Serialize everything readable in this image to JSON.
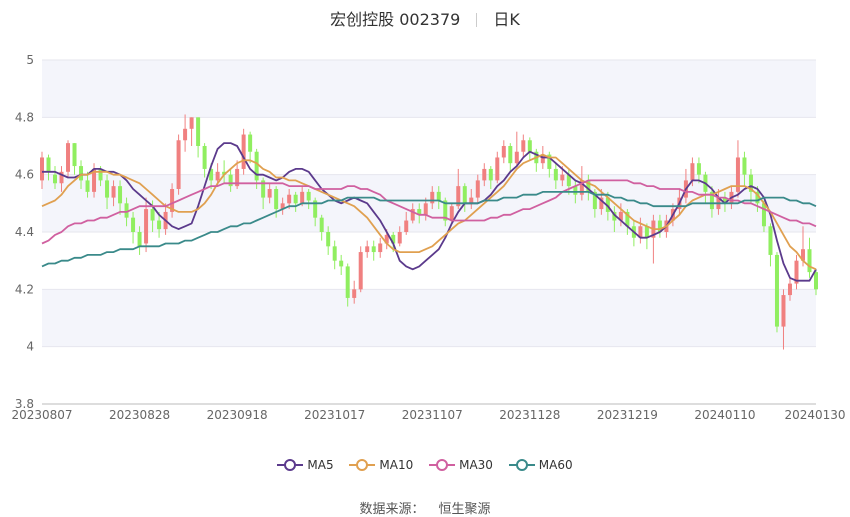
{
  "header": {
    "title": "宏创控股 002379",
    "period": "日K"
  },
  "source": {
    "label": "数据来源：",
    "name": "恒生聚源"
  },
  "chart_data": {
    "type": "candlestick",
    "title": "宏创控股 002379",
    "ylim": [
      3.8,
      5
    ],
    "yticks": [
      3.8,
      4,
      4.2,
      4.4,
      4.6,
      4.8,
      5
    ],
    "ytick_labels": [
      "3.8",
      "4",
      "4.2",
      "4.4",
      "4.6",
      "4.8",
      "5"
    ],
    "xtick_labels": [
      "20230807",
      "20230828",
      "20230918",
      "20231017",
      "20231107",
      "20231128",
      "20231219",
      "20240110",
      "20240130"
    ],
    "xtick_index": [
      0,
      15,
      30,
      45,
      60,
      75,
      90,
      105,
      119
    ],
    "grid": true,
    "colors": {
      "up": "#f08080",
      "down": "#90ee60",
      "ma5": "#5b3a8c",
      "ma10": "#e0a050",
      "ma30": "#d060a0",
      "ma60": "#3a8a8a"
    },
    "candles": [
      [
        4.58,
        4.66,
        4.68,
        4.55
      ],
      [
        4.66,
        4.61,
        4.67,
        4.58
      ],
      [
        4.6,
        4.57,
        4.63,
        4.55
      ],
      [
        4.57,
        4.61,
        4.63,
        4.54
      ],
      [
        4.61,
        4.71,
        4.72,
        4.59
      ],
      [
        4.71,
        4.63,
        4.71,
        4.6
      ],
      [
        4.63,
        4.58,
        4.65,
        4.55
      ],
      [
        4.58,
        4.54,
        4.61,
        4.52
      ],
      [
        4.54,
        4.62,
        4.64,
        4.52
      ],
      [
        4.62,
        4.58,
        4.63,
        4.56
      ],
      [
        4.58,
        4.52,
        4.6,
        4.48
      ],
      [
        4.52,
        4.56,
        4.58,
        4.49
      ],
      [
        4.56,
        4.5,
        4.58,
        4.46
      ],
      [
        4.5,
        4.45,
        4.52,
        4.42
      ],
      [
        4.45,
        4.4,
        4.47,
        4.36
      ],
      [
        4.4,
        4.35,
        4.42,
        4.32
      ],
      [
        4.36,
        4.48,
        4.52,
        4.33
      ],
      [
        4.48,
        4.44,
        4.51,
        4.4
      ],
      [
        4.44,
        4.41,
        4.47,
        4.38
      ],
      [
        4.41,
        4.47,
        4.5,
        4.39
      ],
      [
        4.47,
        4.55,
        4.57,
        4.45
      ],
      [
        4.55,
        4.72,
        4.74,
        4.53
      ],
      [
        4.72,
        4.76,
        4.81,
        4.68
      ],
      [
        4.76,
        4.8,
        4.8,
        4.7
      ],
      [
        4.8,
        4.7,
        4.8,
        4.66
      ],
      [
        4.7,
        4.62,
        4.71,
        4.59
      ],
      [
        4.62,
        4.58,
        4.64,
        4.55
      ],
      [
        4.58,
        4.61,
        4.64,
        4.56
      ],
      [
        4.61,
        4.6,
        4.65,
        4.57
      ],
      [
        4.6,
        4.56,
        4.62,
        4.54
      ],
      [
        4.56,
        4.62,
        4.65,
        4.55
      ],
      [
        4.62,
        4.74,
        4.76,
        4.6
      ],
      [
        4.74,
        4.68,
        4.75,
        4.64
      ],
      [
        4.68,
        4.58,
        4.69,
        4.55
      ],
      [
        4.58,
        4.52,
        4.59,
        4.48
      ],
      [
        4.52,
        4.55,
        4.57,
        4.5
      ],
      [
        4.55,
        4.48,
        4.56,
        4.45
      ],
      [
        4.48,
        4.5,
        4.52,
        4.46
      ],
      [
        4.5,
        4.53,
        4.55,
        4.48
      ],
      [
        4.53,
        4.5,
        4.54,
        4.47
      ],
      [
        4.5,
        4.54,
        4.56,
        4.49
      ],
      [
        4.54,
        4.51,
        4.55,
        4.48
      ],
      [
        4.51,
        4.45,
        4.52,
        4.42
      ],
      [
        4.45,
        4.4,
        4.46,
        4.37
      ],
      [
        4.4,
        4.35,
        4.42,
        4.32
      ],
      [
        4.35,
        4.3,
        4.37,
        4.27
      ],
      [
        4.3,
        4.28,
        4.32,
        4.25
      ],
      [
        4.28,
        4.17,
        4.29,
        4.14
      ],
      [
        4.17,
        4.2,
        4.23,
        4.15
      ],
      [
        4.2,
        4.33,
        4.35,
        4.19
      ],
      [
        4.33,
        4.35,
        4.37,
        4.31
      ],
      [
        4.35,
        4.33,
        4.37,
        4.3
      ],
      [
        4.33,
        4.36,
        4.38,
        4.31
      ],
      [
        4.36,
        4.39,
        4.41,
        4.34
      ],
      [
        4.39,
        4.36,
        4.4,
        4.33
      ],
      [
        4.36,
        4.4,
        4.42,
        4.35
      ],
      [
        4.4,
        4.44,
        4.47,
        4.39
      ],
      [
        4.44,
        4.48,
        4.5,
        4.43
      ],
      [
        4.48,
        4.46,
        4.5,
        4.43
      ],
      [
        4.46,
        4.5,
        4.52,
        4.44
      ],
      [
        4.5,
        4.54,
        4.56,
        4.48
      ],
      [
        4.54,
        4.51,
        4.56,
        4.48
      ],
      [
        4.51,
        4.44,
        4.52,
        4.42
      ],
      [
        4.44,
        4.49,
        4.5,
        4.43
      ],
      [
        4.49,
        4.56,
        4.62,
        4.48
      ],
      [
        4.56,
        4.5,
        4.57,
        4.47
      ],
      [
        4.5,
        4.52,
        4.55,
        4.48
      ],
      [
        4.52,
        4.58,
        4.6,
        4.5
      ],
      [
        4.58,
        4.62,
        4.64,
        4.56
      ],
      [
        4.62,
        4.58,
        4.63,
        4.55
      ],
      [
        4.58,
        4.66,
        4.68,
        4.57
      ],
      [
        4.66,
        4.7,
        4.72,
        4.64
      ],
      [
        4.7,
        4.64,
        4.71,
        4.61
      ],
      [
        4.64,
        4.68,
        4.75,
        4.63
      ],
      [
        4.68,
        4.72,
        4.74,
        4.66
      ],
      [
        4.72,
        4.68,
        4.73,
        4.65
      ],
      [
        4.68,
        4.64,
        4.69,
        4.61
      ],
      [
        4.64,
        4.67,
        4.7,
        4.62
      ],
      [
        4.67,
        4.62,
        4.68,
        4.59
      ],
      [
        4.62,
        4.58,
        4.64,
        4.55
      ],
      [
        4.58,
        4.6,
        4.63,
        4.56
      ],
      [
        4.6,
        4.56,
        4.62,
        4.53
      ],
      [
        4.56,
        4.53,
        4.58,
        4.5
      ],
      [
        4.53,
        4.58,
        4.63,
        4.51
      ],
      [
        4.58,
        4.54,
        4.6,
        4.51
      ],
      [
        4.54,
        4.48,
        4.55,
        4.45
      ],
      [
        4.48,
        4.52,
        4.55,
        4.46
      ],
      [
        4.52,
        4.47,
        4.54,
        4.44
      ],
      [
        4.47,
        4.44,
        4.49,
        4.4
      ],
      [
        4.44,
        4.47,
        4.5,
        4.42
      ],
      [
        4.47,
        4.42,
        4.48,
        4.39
      ],
      [
        4.42,
        4.38,
        4.44,
        4.35
      ],
      [
        4.38,
        4.42,
        4.45,
        4.36
      ],
      [
        4.42,
        4.38,
        4.43,
        4.34
      ],
      [
        4.38,
        4.44,
        4.46,
        4.29
      ],
      [
        4.44,
        4.4,
        4.46,
        4.38
      ],
      [
        4.4,
        4.44,
        4.46,
        4.38
      ],
      [
        4.44,
        4.48,
        4.5,
        4.42
      ],
      [
        4.48,
        4.52,
        4.55,
        4.46
      ],
      [
        4.52,
        4.58,
        4.62,
        4.5
      ],
      [
        4.58,
        4.64,
        4.66,
        4.56
      ],
      [
        4.64,
        4.6,
        4.66,
        4.57
      ],
      [
        4.6,
        4.54,
        4.61,
        4.5
      ],
      [
        4.54,
        4.48,
        4.56,
        4.45
      ],
      [
        4.48,
        4.52,
        4.55,
        4.46
      ],
      [
        4.52,
        4.5,
        4.54,
        4.47
      ],
      [
        4.5,
        4.54,
        4.56,
        4.48
      ],
      [
        4.54,
        4.66,
        4.72,
        4.52
      ],
      [
        4.66,
        4.6,
        4.68,
        4.56
      ],
      [
        4.6,
        4.54,
        4.62,
        4.5
      ],
      [
        4.54,
        4.5,
        4.56,
        4.47
      ],
      [
        4.5,
        4.42,
        4.51,
        4.4
      ],
      [
        4.42,
        4.32,
        4.43,
        4.28
      ],
      [
        4.32,
        4.07,
        4.33,
        4.05
      ],
      [
        4.07,
        4.18,
        4.2,
        3.99
      ],
      [
        4.18,
        4.22,
        4.24,
        4.16
      ],
      [
        4.22,
        4.3,
        4.32,
        4.2
      ],
      [
        4.3,
        4.34,
        4.42,
        4.28
      ],
      [
        4.34,
        4.26,
        4.38,
        4.24
      ],
      [
        4.26,
        4.2,
        4.27,
        4.18
      ]
    ],
    "series": [
      {
        "name": "MA5",
        "values": [
          4.61,
          4.61,
          4.61,
          4.6,
          4.59,
          4.59,
          4.6,
          4.6,
          4.62,
          4.62,
          4.61,
          4.61,
          4.6,
          4.58,
          4.55,
          4.53,
          4.51,
          4.49,
          4.46,
          4.44,
          4.42,
          4.41,
          4.42,
          4.43,
          4.49,
          4.56,
          4.63,
          4.69,
          4.71,
          4.71,
          4.7,
          4.66,
          4.62,
          4.6,
          4.6,
          4.59,
          4.58,
          4.59,
          4.61,
          4.62,
          4.62,
          4.61,
          4.58,
          4.55,
          4.53,
          4.51,
          4.5,
          4.51,
          4.52,
          4.51,
          4.5,
          4.47,
          4.44,
          4.4,
          4.36,
          4.3,
          4.28,
          4.27,
          4.28,
          4.3,
          4.32,
          4.34,
          4.38,
          4.43,
          4.47,
          4.5,
          4.5,
          4.5,
          4.51,
          4.53,
          4.56,
          4.58,
          4.61,
          4.63,
          4.66,
          4.68,
          4.67,
          4.66,
          4.66,
          4.64,
          4.62,
          4.6,
          4.58,
          4.57,
          4.55,
          4.53,
          4.51,
          4.49,
          4.46,
          4.44,
          4.42,
          4.4,
          4.38,
          4.38,
          4.39,
          4.4,
          4.42,
          4.46,
          4.5,
          4.55,
          4.58,
          4.58,
          4.57,
          4.55,
          4.52,
          4.5,
          4.52,
          4.53,
          4.55,
          4.56,
          4.55,
          4.52,
          4.46,
          4.37,
          4.29,
          4.24,
          4.23,
          4.23,
          4.23,
          4.27
        ]
      },
      {
        "name": "MA10",
        "values": [
          4.49,
          4.5,
          4.51,
          4.53,
          4.56,
          4.58,
          4.6,
          4.6,
          4.61,
          4.61,
          4.61,
          4.6,
          4.6,
          4.59,
          4.58,
          4.57,
          4.55,
          4.53,
          4.51,
          4.49,
          4.48,
          4.47,
          4.47,
          4.47,
          4.48,
          4.5,
          4.53,
          4.57,
          4.6,
          4.62,
          4.64,
          4.65,
          4.65,
          4.64,
          4.62,
          4.61,
          4.59,
          4.59,
          4.58,
          4.58,
          4.57,
          4.56,
          4.55,
          4.54,
          4.53,
          4.52,
          4.51,
          4.5,
          4.49,
          4.47,
          4.45,
          4.42,
          4.39,
          4.36,
          4.34,
          4.33,
          4.33,
          4.33,
          4.33,
          4.34,
          4.35,
          4.37,
          4.39,
          4.41,
          4.43,
          4.44,
          4.46,
          4.48,
          4.5,
          4.52,
          4.54,
          4.56,
          4.59,
          4.62,
          4.64,
          4.65,
          4.66,
          4.67,
          4.66,
          4.66,
          4.64,
          4.62,
          4.6,
          4.58,
          4.57,
          4.56,
          4.54,
          4.52,
          4.5,
          4.48,
          4.46,
          4.44,
          4.43,
          4.42,
          4.41,
          4.41,
          4.42,
          4.44,
          4.46,
          4.49,
          4.51,
          4.52,
          4.53,
          4.53,
          4.54,
          4.55,
          4.56,
          4.56,
          4.56,
          4.55,
          4.53,
          4.5,
          4.47,
          4.43,
          4.39,
          4.35,
          4.33,
          4.3,
          4.28,
          4.27
        ]
      },
      {
        "name": "MA30",
        "values": [
          4.36,
          4.37,
          4.39,
          4.4,
          4.42,
          4.43,
          4.43,
          4.44,
          4.44,
          4.45,
          4.45,
          4.46,
          4.47,
          4.47,
          4.48,
          4.49,
          4.49,
          4.49,
          4.49,
          4.49,
          4.5,
          4.51,
          4.52,
          4.53,
          4.54,
          4.55,
          4.56,
          4.56,
          4.57,
          4.57,
          4.57,
          4.57,
          4.57,
          4.57,
          4.57,
          4.57,
          4.57,
          4.57,
          4.56,
          4.56,
          4.56,
          4.56,
          4.55,
          4.55,
          4.55,
          4.55,
          4.55,
          4.56,
          4.56,
          4.55,
          4.55,
          4.54,
          4.53,
          4.51,
          4.5,
          4.49,
          4.48,
          4.47,
          4.46,
          4.46,
          4.45,
          4.45,
          4.45,
          4.44,
          4.44,
          4.44,
          4.44,
          4.44,
          4.44,
          4.45,
          4.45,
          4.46,
          4.46,
          4.47,
          4.48,
          4.48,
          4.49,
          4.5,
          4.51,
          4.52,
          4.54,
          4.55,
          4.56,
          4.57,
          4.58,
          4.58,
          4.58,
          4.58,
          4.58,
          4.58,
          4.58,
          4.57,
          4.57,
          4.56,
          4.56,
          4.55,
          4.55,
          4.55,
          4.55,
          4.54,
          4.54,
          4.53,
          4.53,
          4.53,
          4.52,
          4.52,
          4.51,
          4.51,
          4.5,
          4.5,
          4.49,
          4.48,
          4.47,
          4.46,
          4.45,
          4.44,
          4.44,
          4.43,
          4.43,
          4.42
        ]
      },
      {
        "name": "MA60",
        "values": [
          4.28,
          4.29,
          4.29,
          4.3,
          4.3,
          4.31,
          4.31,
          4.32,
          4.32,
          4.32,
          4.33,
          4.33,
          4.34,
          4.34,
          4.34,
          4.35,
          4.35,
          4.35,
          4.35,
          4.36,
          4.36,
          4.36,
          4.37,
          4.37,
          4.38,
          4.39,
          4.4,
          4.4,
          4.41,
          4.42,
          4.42,
          4.43,
          4.43,
          4.44,
          4.45,
          4.46,
          4.47,
          4.48,
          4.49,
          4.49,
          4.5,
          4.5,
          4.5,
          4.5,
          4.51,
          4.51,
          4.51,
          4.52,
          4.52,
          4.52,
          4.52,
          4.52,
          4.51,
          4.51,
          4.51,
          4.51,
          4.51,
          4.51,
          4.51,
          4.51,
          4.51,
          4.51,
          4.5,
          4.5,
          4.5,
          4.5,
          4.5,
          4.5,
          4.51,
          4.51,
          4.51,
          4.52,
          4.52,
          4.52,
          4.53,
          4.53,
          4.53,
          4.54,
          4.54,
          4.54,
          4.54,
          4.54,
          4.54,
          4.54,
          4.54,
          4.53,
          4.53,
          4.53,
          4.52,
          4.52,
          4.51,
          4.51,
          4.5,
          4.5,
          4.49,
          4.49,
          4.49,
          4.49,
          4.49,
          4.49,
          4.5,
          4.5,
          4.5,
          4.5,
          4.5,
          4.5,
          4.5,
          4.5,
          4.51,
          4.51,
          4.51,
          4.52,
          4.52,
          4.52,
          4.52,
          4.51,
          4.51,
          4.5,
          4.5,
          4.49
        ]
      }
    ],
    "legend": [
      "MA5",
      "MA10",
      "MA30",
      "MA60"
    ],
    "legend_position": "bottom"
  }
}
